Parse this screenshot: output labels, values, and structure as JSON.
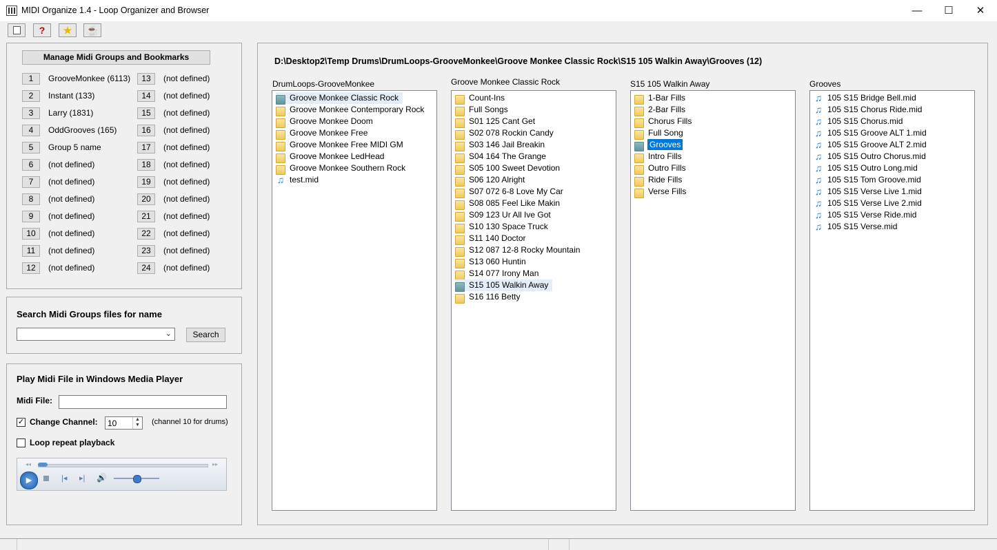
{
  "window": {
    "title": "MIDI Organize 1.4 - Loop Organizer and Browser",
    "minimize": "—",
    "maximize": "☐",
    "close": "✕"
  },
  "toolbar": {
    "buttons": [
      {
        "name": "new-icon",
        "glyph": ""
      },
      {
        "name": "help-icon",
        "glyph": "?"
      },
      {
        "name": "star-icon",
        "glyph": "★"
      },
      {
        "name": "coffee-icon",
        "glyph": "☕"
      }
    ]
  },
  "groups": {
    "manage_label": "Manage Midi Groups and Bookmarks",
    "left": [
      {
        "num": "1",
        "label": "GrooveMonkee (6113)"
      },
      {
        "num": "2",
        "label": "Instant (133)"
      },
      {
        "num": "3",
        "label": "Larry (1831)"
      },
      {
        "num": "4",
        "label": "OddGrooves (165)"
      },
      {
        "num": "5",
        "label": "Group 5 name"
      },
      {
        "num": "6",
        "label": "(not defined)"
      },
      {
        "num": "7",
        "label": "(not defined)"
      },
      {
        "num": "8",
        "label": "(not defined)"
      },
      {
        "num": "9",
        "label": "(not defined)"
      },
      {
        "num": "10",
        "label": "(not defined)"
      },
      {
        "num": "11",
        "label": "(not defined)"
      },
      {
        "num": "12",
        "label": "(not defined)"
      }
    ],
    "right": [
      {
        "num": "13",
        "label": "(not defined)"
      },
      {
        "num": "14",
        "label": "(not defined)"
      },
      {
        "num": "15",
        "label": "(not defined)"
      },
      {
        "num": "16",
        "label": "(not defined)"
      },
      {
        "num": "17",
        "label": "(not defined)"
      },
      {
        "num": "18",
        "label": "(not defined)"
      },
      {
        "num": "19",
        "label": "(not defined)"
      },
      {
        "num": "20",
        "label": "(not defined)"
      },
      {
        "num": "21",
        "label": "(not defined)"
      },
      {
        "num": "22",
        "label": "(not defined)"
      },
      {
        "num": "23",
        "label": "(not defined)"
      },
      {
        "num": "24",
        "label": "(not defined)"
      }
    ]
  },
  "search": {
    "title": "Search Midi Groups files for name",
    "value": "",
    "button": "Search"
  },
  "player": {
    "title": "Play Midi File in Windows Media Player",
    "midi_file_label": "Midi File:",
    "midi_file_value": "",
    "change_channel_label": "Change Channel:",
    "change_channel_checked": true,
    "channel_value": "10",
    "channel_note": "(channel 10 for drums)",
    "loop_label": "Loop repeat playback",
    "loop_checked": false
  },
  "browser": {
    "path": "D:\\Desktop2\\Temp Drums\\DrumLoops-GrooveMonkee\\Groove Monkee Classic Rock\\S15 105 Walkin Away\\Grooves  (12)",
    "columns": [
      {
        "title": "DrumLoops-GrooveMonkee",
        "items": [
          {
            "type": "folder",
            "label": "Groove Monkee Classic Rock",
            "state": "open"
          },
          {
            "type": "folder",
            "label": "Groove Monkee Contemporary Rock"
          },
          {
            "type": "folder",
            "label": "Groove Monkee Doom"
          },
          {
            "type": "folder",
            "label": "Groove Monkee Free"
          },
          {
            "type": "folder",
            "label": "Groove Monkee Free MIDI GM"
          },
          {
            "type": "folder",
            "label": "Groove Monkee LedHead"
          },
          {
            "type": "folder",
            "label": "Groove Monkee Southern Rock"
          },
          {
            "type": "file",
            "label": "test.mid"
          }
        ]
      },
      {
        "title": "Groove Monkee Classic Rock",
        "items": [
          {
            "type": "folder",
            "label": "Count-Ins"
          },
          {
            "type": "folder",
            "label": "Full Songs"
          },
          {
            "type": "folder",
            "label": "S01 125 Cant Get"
          },
          {
            "type": "folder",
            "label": "S02 078 Rockin Candy"
          },
          {
            "type": "folder",
            "label": "S03 146 Jail Breakin"
          },
          {
            "type": "folder",
            "label": "S04 164 The Grange"
          },
          {
            "type": "folder",
            "label": "S05 100 Sweet Devotion"
          },
          {
            "type": "folder",
            "label": "S06 120 Alright"
          },
          {
            "type": "folder",
            "label": "S07 072 6-8 Love My Car"
          },
          {
            "type": "folder",
            "label": "S08 085 Feel Like Makin"
          },
          {
            "type": "folder",
            "label": "S09 123 Ur All Ive Got"
          },
          {
            "type": "folder",
            "label": "S10 130 Space Truck"
          },
          {
            "type": "folder",
            "label": "S11 140 Doctor"
          },
          {
            "type": "folder",
            "label": "S12 087 12-8 Rocky Mountain"
          },
          {
            "type": "folder",
            "label": "S13 060 Huntin"
          },
          {
            "type": "folder",
            "label": "S14 077 Irony Man"
          },
          {
            "type": "folder",
            "label": "S15 105 Walkin Away",
            "state": "open"
          },
          {
            "type": "folder",
            "label": "S16 116 Betty"
          }
        ]
      },
      {
        "title": "S15 105 Walkin Away",
        "items": [
          {
            "type": "folder",
            "label": "1-Bar Fills"
          },
          {
            "type": "folder",
            "label": "2-Bar Fills"
          },
          {
            "type": "folder",
            "label": "Chorus Fills"
          },
          {
            "type": "folder",
            "label": "Full Song"
          },
          {
            "type": "folder",
            "label": "Grooves",
            "state": "selected"
          },
          {
            "type": "folder",
            "label": "Intro Fills"
          },
          {
            "type": "folder",
            "label": "Outro Fills"
          },
          {
            "type": "folder",
            "label": "Ride Fills"
          },
          {
            "type": "folder",
            "label": "Verse Fills"
          }
        ]
      },
      {
        "title": "Grooves",
        "items": [
          {
            "type": "file",
            "label": "105 S15 Bridge Bell.mid"
          },
          {
            "type": "file",
            "label": "105 S15 Chorus Ride.mid"
          },
          {
            "type": "file",
            "label": "105 S15 Chorus.mid"
          },
          {
            "type": "file",
            "label": "105 S15 Groove ALT 1.mid"
          },
          {
            "type": "file",
            "label": "105 S15 Groove ALT 2.mid"
          },
          {
            "type": "file",
            "label": "105 S15 Outro Chorus.mid"
          },
          {
            "type": "file",
            "label": "105 S15 Outro Long.mid"
          },
          {
            "type": "file",
            "label": "105 S15 Tom Groove.mid"
          },
          {
            "type": "file",
            "label": "105 S15 Verse Live 1.mid"
          },
          {
            "type": "file",
            "label": "105 S15 Verse Live 2.mid"
          },
          {
            "type": "file",
            "label": "105 S15 Verse Ride.mid"
          },
          {
            "type": "file",
            "label": "105 S15 Verse.mid"
          }
        ]
      }
    ]
  }
}
